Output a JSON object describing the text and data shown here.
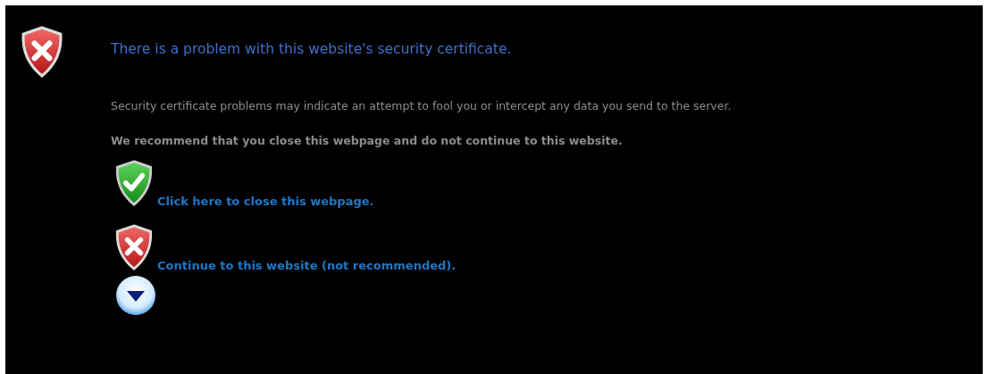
{
  "title": "There is a problem with this website's security certificate.",
  "paragraphs": [
    {
      "text": "Security certificate problems may indicate an attempt to fool you or intercept any data you send to the server.",
      "bold": false
    },
    {
      "text": "We recommend that you close this webpage and do not continue to this website.",
      "bold": true
    }
  ],
  "links": [
    {
      "kind": "safe",
      "label": "Click here to close this webpage."
    },
    {
      "kind": "unsafe",
      "label": "Continue to this website (not recommended)."
    }
  ],
  "more_information": {
    "expanded": false
  }
}
